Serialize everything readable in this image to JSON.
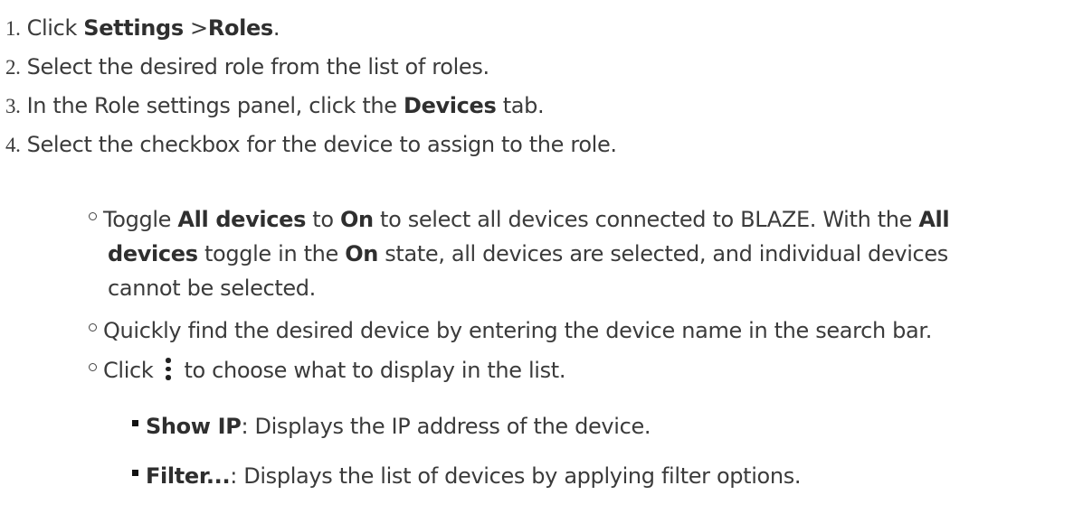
{
  "steps": [
    {
      "num": "1.",
      "pre": "Click ",
      "bold1": "Settings",
      "sep": " >",
      "bold2": "Roles",
      "post": "."
    },
    {
      "num": "2.",
      "text": "Select the desired role from the list of roles."
    },
    {
      "num": "3.",
      "pre": "In the Role settings panel, click the ",
      "bold": "Devices",
      "post": " tab."
    },
    {
      "num": "4.",
      "text": "Select the checkbox for the device to assign to the role."
    }
  ],
  "bullets": [
    {
      "l1": {
        "a": "Toggle ",
        "b1": "All devices",
        "c": " to ",
        "b2": "On",
        "d": " to select all devices connected to BLAZE. With the ",
        "b3": "All"
      },
      "l2": {
        "b1": "devices",
        "a": " toggle in the ",
        "b2": "On",
        "c": " state, all devices are selected, and individual devices"
      },
      "l3": "cannot be selected."
    },
    {
      "text": "Quickly find the desired device by entering the device name in the search bar."
    },
    {
      "pre": "Click",
      "post": "to choose what to display in the list.",
      "icon": "kebab-menu-icon"
    }
  ],
  "subbullets": [
    {
      "bold": "Show IP",
      "text": ": Displays the IP address of the device."
    },
    {
      "bold": "Filter...",
      "text": ": Displays the list of devices by applying filter options."
    }
  ]
}
